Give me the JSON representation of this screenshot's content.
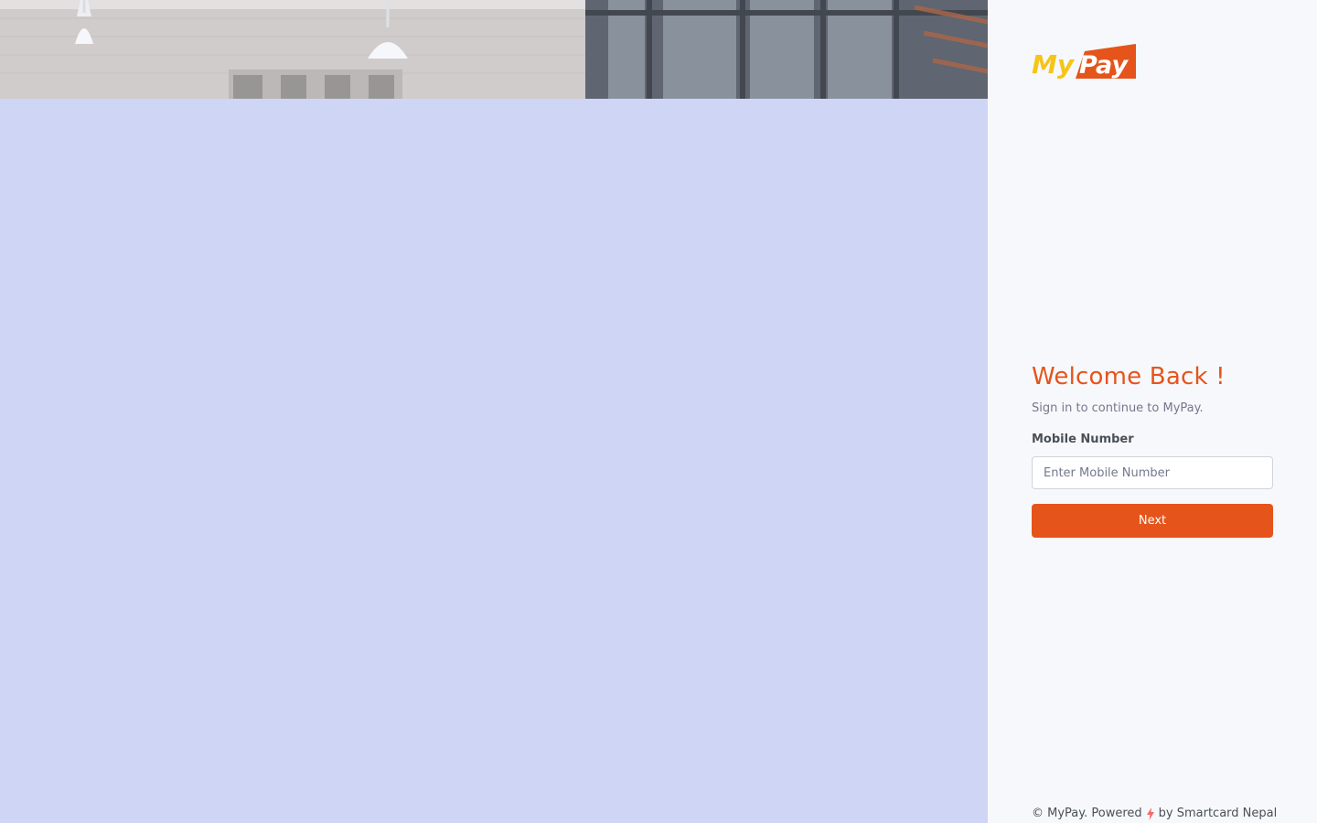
{
  "brand": {
    "logo_text_my": "My",
    "logo_text_pay": "Pay",
    "colors": {
      "accent": "#e5541b",
      "logo_yellow": "#f5c518",
      "left_panel_tint": "#cfd5f5",
      "right_panel_bg": "#f7f8fb"
    }
  },
  "auth": {
    "title": "Welcome Back !",
    "subtitle": "Sign in to continue to MyPay.",
    "mobile_label": "Mobile Number",
    "mobile_value": "",
    "mobile_placeholder": "Enter Mobile Number",
    "next_label": "Next"
  },
  "footer": {
    "prefix": "© MyPay. Powered",
    "icon": "bolt-icon",
    "suffix": "by Smartcard Nepal"
  }
}
